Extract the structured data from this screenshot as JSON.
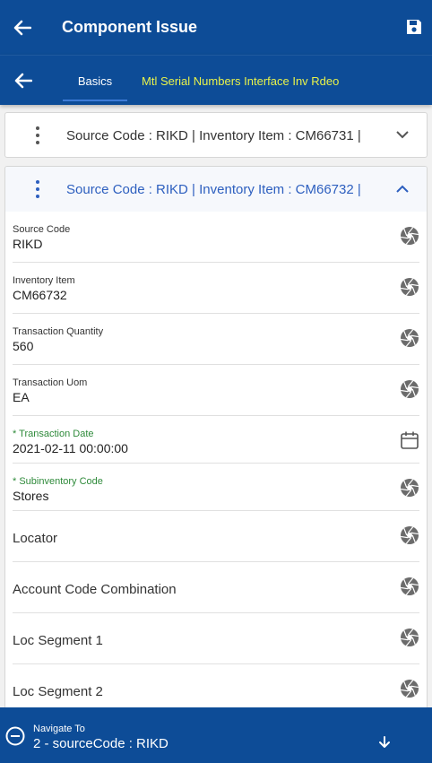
{
  "header": {
    "title": "Component Issue",
    "back_icon": "arrow-left-icon",
    "save_icon": "save-icon"
  },
  "tabs": {
    "back_icon": "arrow-left-icon",
    "items": [
      {
        "label": "Basics",
        "active": true
      },
      {
        "label": "Mtl Serial Numbers Interface Inv Rdeo",
        "active": false
      }
    ]
  },
  "cards": [
    {
      "header_text": "Source Code  : RIKD | Inventory Item  : CM66731 |",
      "expanded": false
    },
    {
      "header_text": "Source Code  : RIKD | Inventory Item  : CM66732 |",
      "expanded": true,
      "fields": [
        {
          "label": "Source Code",
          "value": "RIKD",
          "icon": "aperture-icon"
        },
        {
          "label": "Inventory Item",
          "value": "CM66732",
          "icon": "aperture-icon"
        },
        {
          "label": "Transaction Quantity",
          "value": "560",
          "icon": "aperture-icon"
        },
        {
          "label": "Transaction Uom",
          "value": "EA",
          "icon": "aperture-icon"
        },
        {
          "label": "* Transaction Date",
          "value": "2021-02-11 00:00:00",
          "icon": "calendar-icon",
          "required": true
        },
        {
          "label": "* Subinventory Code",
          "value": "Stores",
          "icon": "aperture-icon",
          "required": true
        },
        {
          "label": "Locator",
          "value": "",
          "icon": "aperture-icon"
        },
        {
          "label": "Account Code Combination",
          "value": "",
          "icon": "aperture-icon"
        },
        {
          "label": "Loc Segment 1",
          "value": "",
          "icon": "aperture-icon"
        },
        {
          "label": "Loc Segment 2",
          "value": "",
          "icon": "aperture-icon"
        }
      ]
    }
  ],
  "navigate": {
    "label": "Navigate To",
    "value": "2 - sourceCode : RIKD"
  },
  "colors": {
    "primary": "#0d4c97",
    "tab_highlight": "#e8f24a",
    "link": "#2d5fbf",
    "required": "#2e8a3a"
  }
}
